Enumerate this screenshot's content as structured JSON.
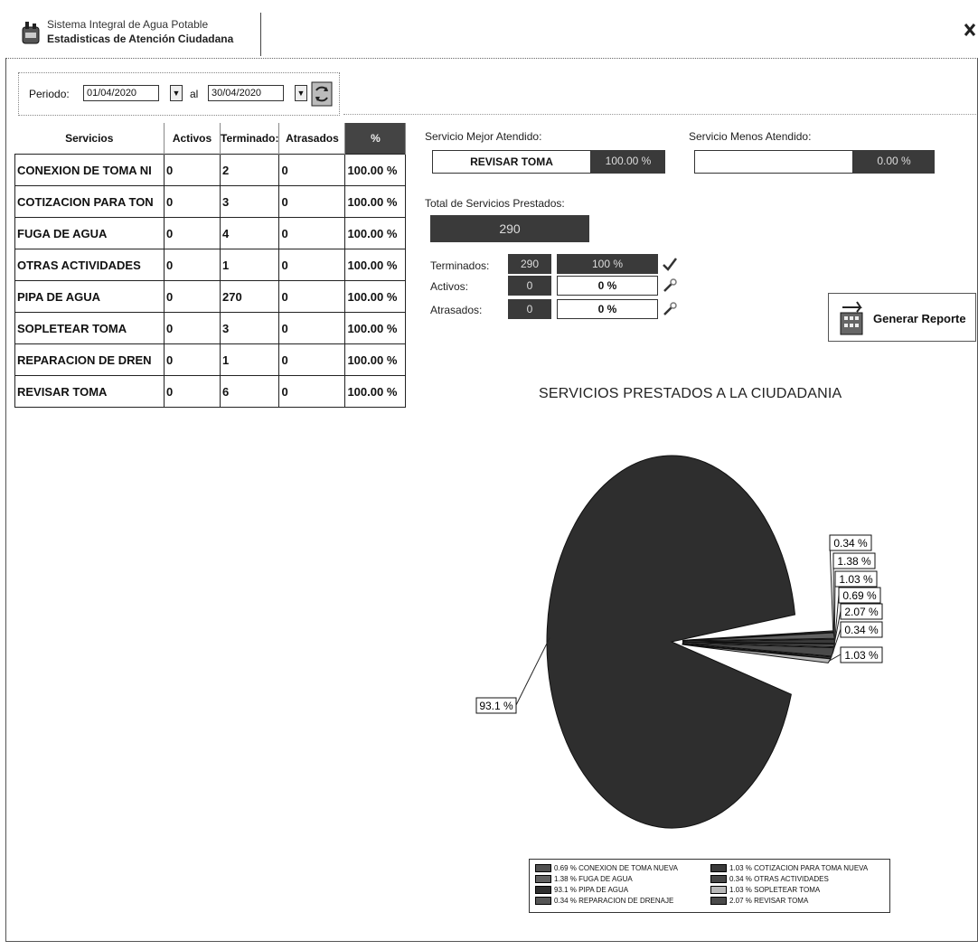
{
  "header": {
    "line1": "Sistema Integral de Agua Potable",
    "line2": "Estadisticas de Atención Ciudadana"
  },
  "period": {
    "label": "Periodo:",
    "from_value": "01/04/2020",
    "separator": "al",
    "to_value": "30/04/2020"
  },
  "table": {
    "headers": [
      "Servicios",
      "Activos",
      "Terminado:",
      "Atrasados",
      "%"
    ],
    "rows": [
      [
        "CONEXION DE TOMA NI",
        "0",
        "2",
        "0",
        "100.00 %"
      ],
      [
        "COTIZACION PARA TON",
        "0",
        "3",
        "0",
        "100.00 %"
      ],
      [
        "FUGA DE AGUA",
        "0",
        "4",
        "0",
        "100.00 %"
      ],
      [
        "OTRAS ACTIVIDADES",
        "0",
        "1",
        "0",
        "100.00 %"
      ],
      [
        "PIPA DE AGUA",
        "0",
        "270",
        "0",
        "100.00 %"
      ],
      [
        "SOPLETEAR TOMA",
        "0",
        "3",
        "0",
        "100.00 %"
      ],
      [
        "REPARACION DE DREN",
        "0",
        "1",
        "0",
        "100.00 %"
      ],
      [
        "REVISAR TOMA",
        "0",
        "6",
        "0",
        "100.00 %"
      ]
    ]
  },
  "summary": {
    "best_label": "Servicio Mejor Atendido:",
    "best_name": "REVISAR TOMA",
    "best_pct": "100.00 %",
    "worst_label": "Servicio Menos Atendido:",
    "worst_name": "",
    "worst_pct": "0.00 %",
    "total_label": "Total de Servicios Prestados:",
    "total_value": "290",
    "terminados_label": "Terminados:",
    "terminados_count": "290",
    "terminados_pct": "100 %",
    "activos_label": "Activos:",
    "activos_count": "0",
    "activos_pct": "0 %",
    "atrasados_label": "Atrasados:",
    "atrasados_count": "0",
    "atrasados_pct": "0 %"
  },
  "report_button": {
    "label": "Generar Reporte"
  },
  "chart_data": {
    "type": "pie",
    "title": "SERVICIOS PRESTADOS A LA CIUDADANIA",
    "slices": [
      {
        "value": 0.69,
        "label": "0.69 %",
        "legend": "0.69 % CONEXION DE TOMA NUEVA"
      },
      {
        "value": 1.03,
        "label": "1.03 %",
        "legend": "1.03 % COTIZACION PARA TOMA NUEVA"
      },
      {
        "value": 1.38,
        "label": "1.38 %",
        "legend": "1.38 % FUGA DE AGUA"
      },
      {
        "value": 0.34,
        "label": "0.34 %",
        "legend": "0.34 % OTRAS ACTIVIDADES"
      },
      {
        "value": 93.1,
        "label": "93.1 %",
        "legend": "93.1 % PIPA DE AGUA"
      },
      {
        "value": 1.03,
        "label": "1.03 %",
        "legend": "1.03 % SOPLETEAR TOMA"
      },
      {
        "value": 0.34,
        "label": "0.34 %",
        "legend": "0.34 % REPARACION DE DRENAJE"
      },
      {
        "value": 2.07,
        "label": "2.07 %",
        "legend": "2.07 % REVISAR TOMA"
      }
    ]
  }
}
